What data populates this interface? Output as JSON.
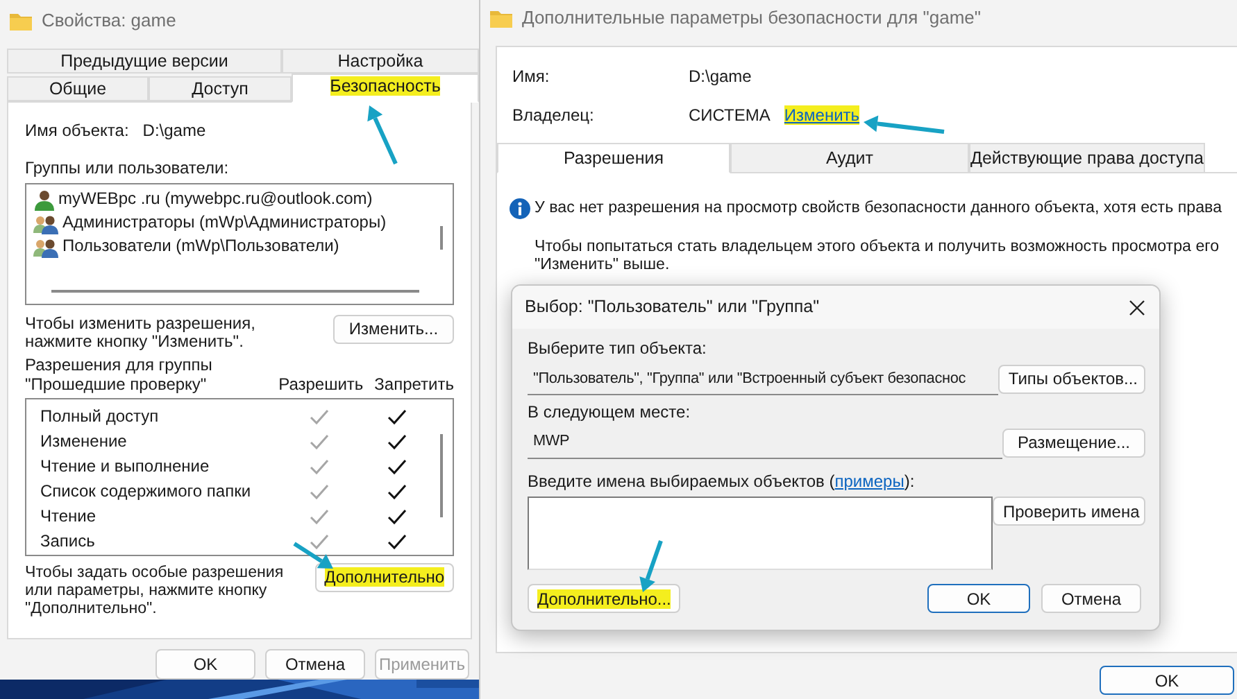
{
  "left_window": {
    "title": "Свойства: game",
    "tab_rows": [
      {
        "tabs": [
          {
            "label": "Предыдущие версии",
            "selected": false
          },
          {
            "label": "Настройка",
            "selected": false
          }
        ]
      },
      {
        "tabs": [
          {
            "label": "Общие",
            "selected": false
          },
          {
            "label": "Доступ",
            "selected": false
          },
          {
            "label": "Безопасность",
            "selected": true,
            "highlighted": true
          }
        ]
      }
    ],
    "object_name_label": "Имя объекта:",
    "object_name": "D:\\game",
    "groups_label": "Группы или пользователи:",
    "principals": [
      {
        "kind": "user",
        "name": "myWEBpc .ru (mywebpc.ru@outlook.com)"
      },
      {
        "kind": "group",
        "name": "Администраторы (mWp\\Администраторы)"
      },
      {
        "kind": "group",
        "name": "Пользователи (mWp\\Пользователи)"
      }
    ],
    "change_hint": "Чтобы изменить разрешения, нажмите кнопку \"Изменить\".",
    "change_button": "Изменить...",
    "permissions_label": "Разрешения для группы \"Прошедшие проверку\"",
    "allow_header": "Разрешить",
    "deny_header": "Запретить",
    "permissions": [
      {
        "label": "Полный доступ",
        "allow": {
          "checked": true,
          "disabled": true
        },
        "deny": {
          "checked": true,
          "disabled": false
        }
      },
      {
        "label": "Изменение",
        "allow": {
          "checked": true,
          "disabled": true
        },
        "deny": {
          "checked": true,
          "disabled": false
        }
      },
      {
        "label": "Чтение и выполнение",
        "allow": {
          "checked": true,
          "disabled": true
        },
        "deny": {
          "checked": true,
          "disabled": false
        }
      },
      {
        "label": "Список содержимого папки",
        "allow": {
          "checked": true,
          "disabled": true
        },
        "deny": {
          "checked": true,
          "disabled": false
        }
      },
      {
        "label": "Чтение",
        "allow": {
          "checked": true,
          "disabled": true
        },
        "deny": {
          "checked": true,
          "disabled": false
        }
      },
      {
        "label": "Запись",
        "allow": {
          "checked": true,
          "disabled": true
        },
        "deny": {
          "checked": true,
          "disabled": false
        }
      }
    ],
    "advanced_hint": "Чтобы задать особые разрешения или параметры, нажмите кнопку \"Дополнительно\".",
    "advanced_button": {
      "label": "Дополнительно",
      "highlighted": true
    },
    "footer_buttons": [
      {
        "label": "OK",
        "disabled": false
      },
      {
        "label": "Отмена",
        "disabled": false
      },
      {
        "label": "Применить",
        "disabled": true
      }
    ]
  },
  "right_window": {
    "title": "Дополнительные параметры безопасности  для \"game\"",
    "name_label": "Имя:",
    "name": "D:\\game",
    "owner_label": "Владелец:",
    "owner": "СИСТЕМА",
    "owner_link": {
      "label": "Изменить",
      "highlighted": true
    },
    "tabs": [
      {
        "label": "Разрешения",
        "selected": true
      },
      {
        "label": "Аудит",
        "selected": false
      },
      {
        "label": "Действующие права доступа",
        "selected": false
      }
    ],
    "info_message": "У вас нет разрешения на просмотр свойств безопасности данного объекта, хотя есть права",
    "hint_lines": [
      "Чтобы попытаться стать владельцем этого объекта и получить возможность просмотра его",
      "\"Изменить\" выше."
    ],
    "ok_button": "OK"
  },
  "dialog": {
    "title": "Выбор: \"Пользователь\" или \"Группа\"",
    "object_type_label": "Выберите тип объекта:",
    "object_type_value": "\"Пользователь\", \"Группа\" или \"Встроенный субъект безопаснос",
    "object_type_button": "Типы объектов...",
    "location_label": "В следующем месте:",
    "location_value": "MWP",
    "location_button": "Размещение...",
    "names_label": {
      "before": "Введите имена выбираемых объектов (",
      "link": "примеры",
      "after": "):"
    },
    "check_names_button": "Проверить имена",
    "advanced_button": {
      "label": "Дополнительно...",
      "highlighted": true
    },
    "ok_button": "OK",
    "cancel_button": "Отмена"
  }
}
